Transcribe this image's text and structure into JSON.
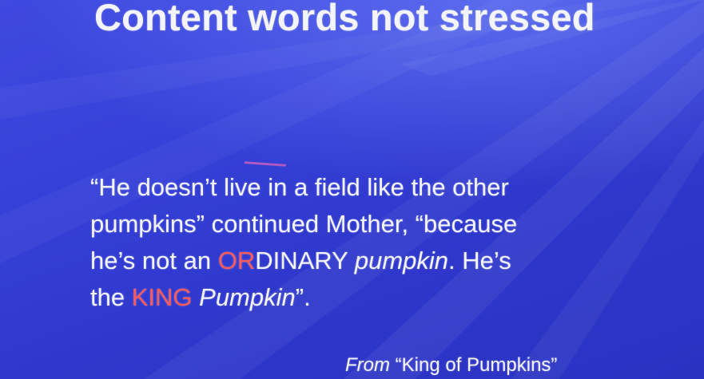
{
  "slide": {
    "title": "Content words not stressed",
    "quote": {
      "line1": "“He doesn’t live in a field like the other",
      "line2": "pumpkins” continued Mother, “because",
      "line3_prefix": "he’s not an ",
      "line3_red": "OR",
      "line3_rest": "DINARY ",
      "line3_italic": "pumpkin",
      "line3_suffix": ". He’s",
      "line4_prefix": "the ",
      "line4_red": "KING",
      "line4_space": " ",
      "line4_italic": "Pumpkin",
      "line4_suffix": "”."
    },
    "source": {
      "from_label": "From",
      "title": " “King of Pumpkins”"
    }
  },
  "colors": {
    "background": "#3540d8",
    "text": "#f4f4ff",
    "emphasis": "#ff5a57"
  }
}
